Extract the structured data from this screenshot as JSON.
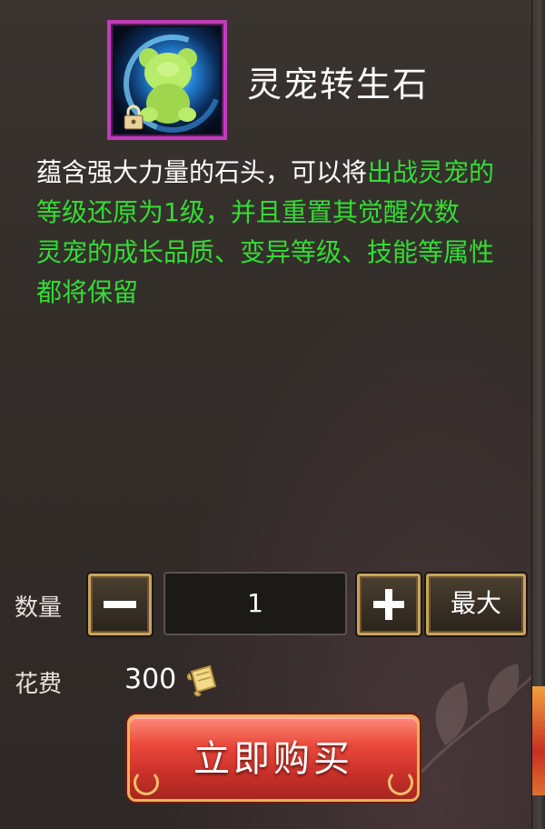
{
  "item": {
    "name": "灵宠转生石",
    "icon": "pet-rebirth-stone-icon",
    "locked_icon": "lock-icon",
    "frame_color": "#c23bbc"
  },
  "description": {
    "part1": "蕴含强大力量的石头，可以将",
    "part2_green": "出战灵宠的等级还原为1级，并且重置其觉醒次数",
    "part3_green": "灵宠的成长品质、变异等级、技能等属性都将保留"
  },
  "quantity": {
    "label": "数量",
    "value": "1",
    "minus_icon": "minus-icon",
    "plus_icon": "plus-icon",
    "max_label": "最大"
  },
  "cost": {
    "label": "花费",
    "value": "300",
    "currency_icon": "scroll-icon"
  },
  "buy_button": {
    "label": "立即购买"
  },
  "colors": {
    "highlight_text": "#33dd33",
    "body_text": "#ffffff",
    "buy_button": "#d8382e",
    "button_border": "#c9a45a"
  }
}
